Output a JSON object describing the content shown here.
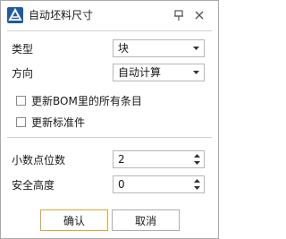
{
  "window": {
    "title": "自动坯料尺寸",
    "icons": {
      "app": "app-logo-icon",
      "pin": "pin-icon",
      "close": "close-icon"
    }
  },
  "fields": {
    "type": {
      "label": "类型",
      "value": "块"
    },
    "direction": {
      "label": "方向",
      "value": "自动计算"
    },
    "decimals": {
      "label": "小数点位数",
      "value": "2"
    },
    "safe_height": {
      "label": "安全高度",
      "value": "0"
    }
  },
  "checkboxes": {
    "update_bom": {
      "label": "更新BOM里的所有条目",
      "checked": false
    },
    "update_standard": {
      "label": "更新标准件",
      "checked": false
    }
  },
  "buttons": {
    "ok": "确认",
    "cancel": "取消"
  },
  "colors": {
    "accent_border": "#d9a63c",
    "icon_blue": "#1d5aa8"
  }
}
